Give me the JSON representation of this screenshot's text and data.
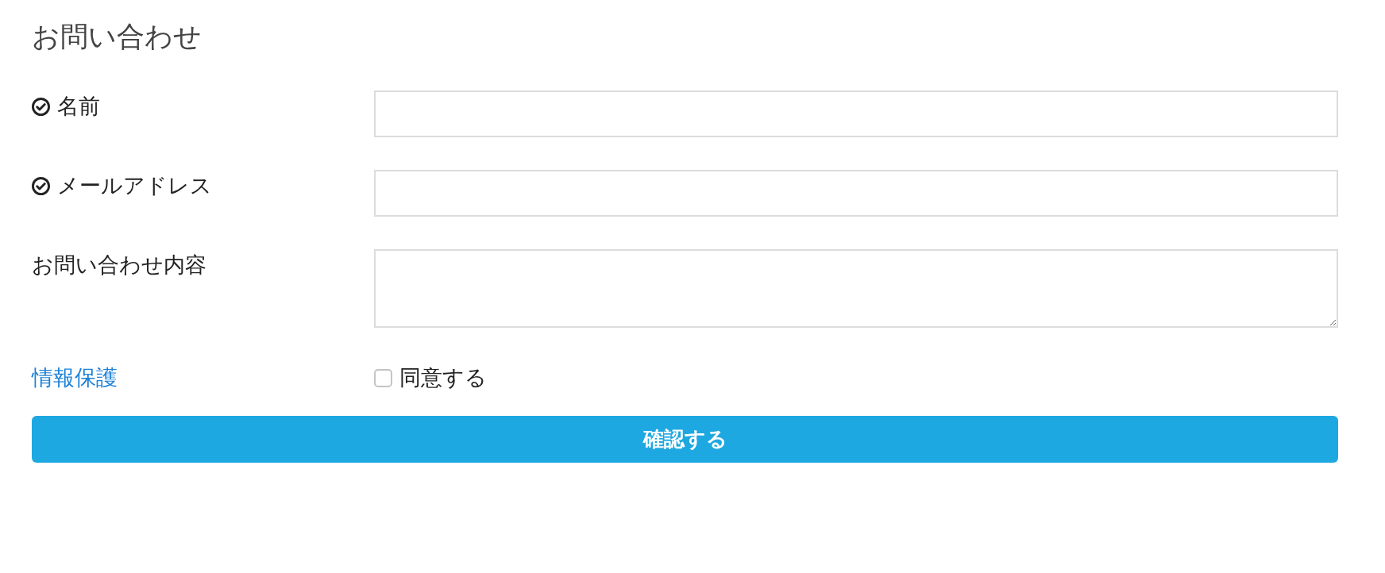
{
  "title": "お問い合わせ",
  "fields": [
    {
      "label": "名前",
      "required": true,
      "kind": "text"
    },
    {
      "label": "メールアドレス",
      "required": true,
      "kind": "text"
    },
    {
      "label": "お問い合わせ内容",
      "required": false,
      "kind": "textarea"
    }
  ],
  "consent": {
    "link": "情報保護",
    "label": "同意する",
    "checked": false
  },
  "submit": "確認する"
}
